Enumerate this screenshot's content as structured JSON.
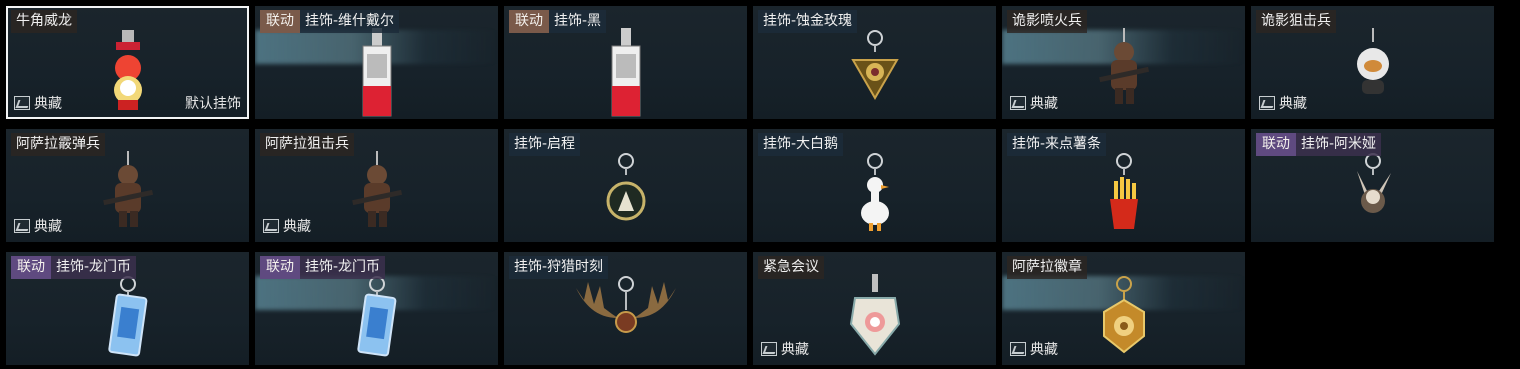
{
  "cards": [
    {
      "tag": "",
      "tag_color": "",
      "name": "牛角威龙",
      "collection": "典藏",
      "default": "默认挂饰",
      "selected": true,
      "shine": false,
      "charm": "red-figure"
    },
    {
      "tag": "联动",
      "tag_color": "brown",
      "name": "挂饰-维什戴尔",
      "collection": "",
      "default": "",
      "selected": false,
      "shine": true,
      "charm": "tag-card"
    },
    {
      "tag": "联动",
      "tag_color": "brown",
      "name": "挂饰-黑",
      "collection": "",
      "default": "",
      "selected": false,
      "shine": false,
      "charm": "tag-card"
    },
    {
      "tag": "",
      "tag_color": "",
      "name": "挂饰-蚀金玫瑰",
      "collection": "",
      "default": "",
      "selected": false,
      "shine": false,
      "charm": "gold-rose"
    },
    {
      "tag": "",
      "tag_color": "",
      "name": "诡影喷火兵",
      "collection": "典藏",
      "default": "",
      "selected": false,
      "shine": true,
      "charm": "soldier-figure"
    },
    {
      "tag": "",
      "tag_color": "",
      "name": "诡影狙击兵",
      "collection": "典藏",
      "default": "",
      "selected": false,
      "shine": false,
      "charm": "white-figure"
    },
    {
      "tag": "",
      "tag_color": "",
      "name": "阿萨拉霰弹兵",
      "collection": "典藏",
      "default": "",
      "selected": false,
      "shine": false,
      "charm": "soldier-figure"
    },
    {
      "tag": "",
      "tag_color": "",
      "name": "阿萨拉狙击兵",
      "collection": "典藏",
      "default": "",
      "selected": false,
      "shine": false,
      "charm": "soldier-figure"
    },
    {
      "tag": "",
      "tag_color": "",
      "name": "挂饰-启程",
      "collection": "",
      "default": "",
      "selected": false,
      "shine": false,
      "charm": "round-medal"
    },
    {
      "tag": "",
      "tag_color": "",
      "name": "挂饰-大白鹅",
      "collection": "",
      "default": "",
      "selected": false,
      "shine": false,
      "charm": "white-goose"
    },
    {
      "tag": "",
      "tag_color": "",
      "name": "挂饰-来点薯条",
      "collection": "",
      "default": "",
      "selected": false,
      "shine": false,
      "charm": "fries"
    },
    {
      "tag": "联动",
      "tag_color": "purple",
      "name": "挂饰-阿米娅",
      "collection": "",
      "default": "",
      "selected": false,
      "shine": false,
      "charm": "bunny"
    },
    {
      "tag": "联动",
      "tag_color": "purple",
      "name": "挂饰-龙门币",
      "collection": "",
      "default": "",
      "selected": false,
      "shine": false,
      "charm": "blue-card"
    },
    {
      "tag": "联动",
      "tag_color": "purple",
      "name": "挂饰-龙门币",
      "collection": "",
      "default": "",
      "selected": false,
      "shine": true,
      "charm": "blue-card"
    },
    {
      "tag": "",
      "tag_color": "",
      "name": "挂饰-狩猎时刻",
      "collection": "",
      "default": "",
      "selected": false,
      "shine": false,
      "charm": "antlers"
    },
    {
      "tag": "",
      "tag_color": "",
      "name": "紧急会议",
      "collection": "典藏",
      "default": "",
      "selected": false,
      "shine": false,
      "charm": "shield-badge"
    },
    {
      "tag": "",
      "tag_color": "",
      "name": "阿萨拉徽章",
      "collection": "典藏",
      "default": "",
      "selected": false,
      "shine": true,
      "charm": "gold-badge"
    }
  ]
}
